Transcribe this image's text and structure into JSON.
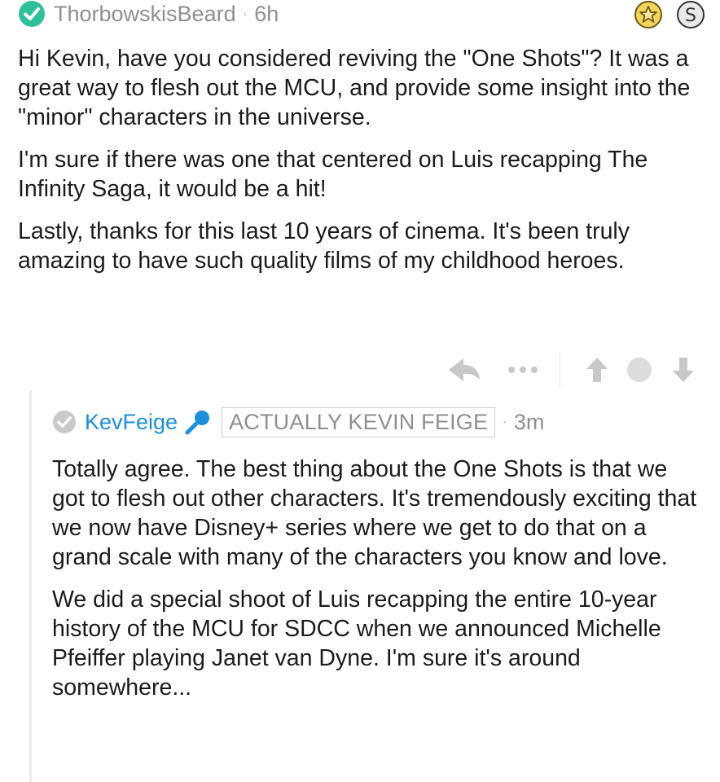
{
  "comment": {
    "username": "ThorbowskisBeard",
    "separator": "·",
    "time": "6h",
    "paragraphs": [
      "Hi Kevin, have you considered reviving the \"One Shots\"? It was a great way to flesh out the MCU, and provide some insight into the \"minor\" characters in the universe.",
      "I'm sure if there was one that centered on Luis recapping The Infinity Saga, it would be a hit!",
      "Lastly, thanks for this last 10 years of cinema. It's been truly amazing to have such quality films of my childhood heroes."
    ],
    "badges": [
      "star-award-icon",
      "silver-coin-icon"
    ],
    "actions": [
      "reply-icon",
      "more-icon",
      "upvote-icon",
      "score-dot",
      "downvote-icon"
    ]
  },
  "reply": {
    "username": "KevFeige",
    "flair": "ACTUALLY KEVIN FEIGE",
    "separator": "·",
    "time": "3m",
    "paragraphs": [
      "Totally agree. The best thing about the One Shots is that we got to flesh out other characters. It's tremendously exciting that we now have Disney+ series where we get to do that on a grand scale with many of the characters you know and love.",
      "We did a special shoot of Luis recapping the entire 10-year history of the MCU for SDCC when we announced Michelle Pfeiffer playing Janet van Dyne. I'm sure it's around somewhere..."
    ]
  },
  "colors": {
    "accent_teal": "#2fbf9a",
    "username_blue": "#1c8fd8",
    "meta_gray": "#8f8f8f",
    "icon_gray": "#c8c8c8"
  }
}
